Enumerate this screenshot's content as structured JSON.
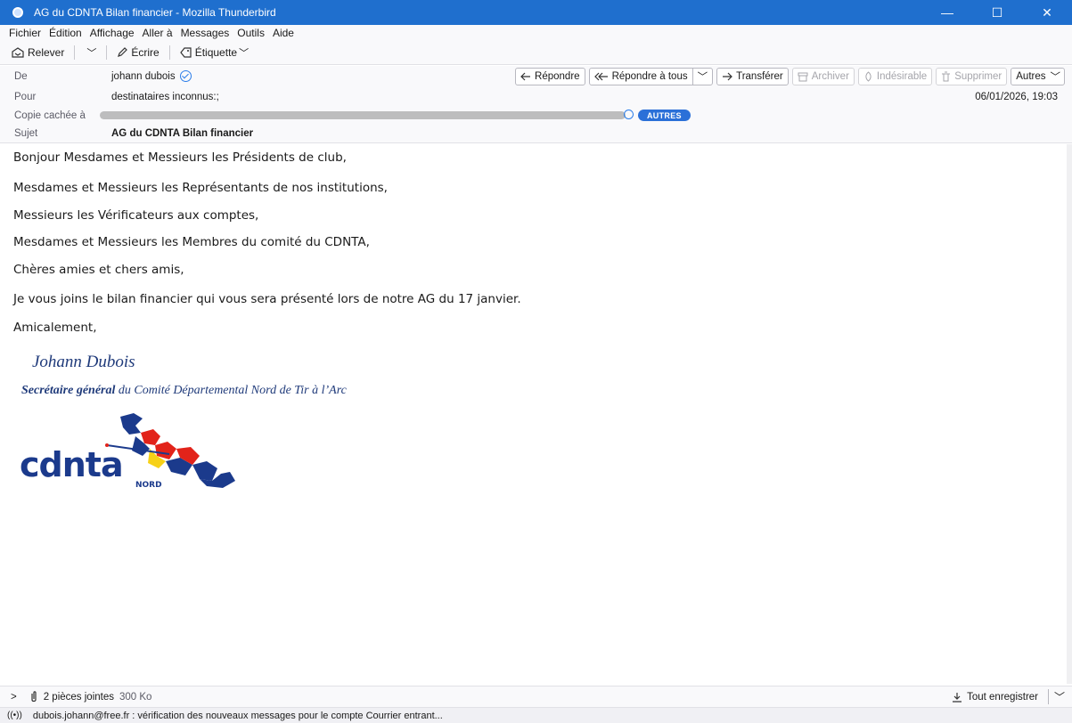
{
  "window": {
    "title": "AG du CDNTA Bilan financier - Mozilla Thunderbird",
    "minimize": "—",
    "maximize": "☐",
    "close": "✕"
  },
  "menu": [
    "Fichier",
    "Édition",
    "Affichage",
    "Aller à",
    "Messages",
    "Outils",
    "Aide"
  ],
  "toolbar": {
    "get_messages": "Relever",
    "write": "Écrire",
    "tag": "Étiquette"
  },
  "header": {
    "from_label": "De",
    "from_value": "johann dubois",
    "to_label": "Pour",
    "to_value": "destinataires inconnus:;",
    "bcc_label": "Copie cachée à",
    "bcc_more": "AUTRES",
    "subject_label": "Sujet",
    "subject_value": "AG du CDNTA Bilan financier",
    "date": "06/01/2026, 19:03",
    "buttons": {
      "reply": "Répondre",
      "reply_all": "Répondre à tous",
      "forward": "Transférer",
      "archive": "Archiver",
      "junk": "Indésirable",
      "delete": "Supprimer",
      "more": "Autres"
    }
  },
  "body": {
    "lines": [
      "Bonjour Mesdames et Messieurs les Présidents de club,",
      "Mesdames et Messieurs les Représentants de nos institutions,",
      "Messieurs les Vérificateurs aux comptes,",
      "Mesdames et Messieurs les Membres du comité du CDNTA,",
      "Chères amies et chers amis,",
      "Je vous joins le bilan financier qui vous sera présenté lors de notre AG du 17 janvier.",
      "Amicalement,"
    ],
    "signature_name": "Johann Dubois",
    "signature_title_bold1": "Secrétaire général",
    "signature_title_rest": " du Comité Départemental Nord de Tir à l’Arc",
    "logo_text": "cdnta",
    "logo_sub": "NORD"
  },
  "attachments": {
    "count_label": "2 pièces jointes",
    "size": "300 Ko",
    "save_all": "Tout enregistrer"
  },
  "status": {
    "text": "dubois.johann@free.fr : vérification des nouveaux messages pour le compte Courrier entrant..."
  },
  "colors": {
    "titlebar": "#1f6fce",
    "accent": "#2b70d8",
    "signature": "#1f3a7a",
    "logo_blue": "#1b3a8c",
    "logo_red": "#e2231a",
    "logo_yellow": "#f7d117"
  }
}
